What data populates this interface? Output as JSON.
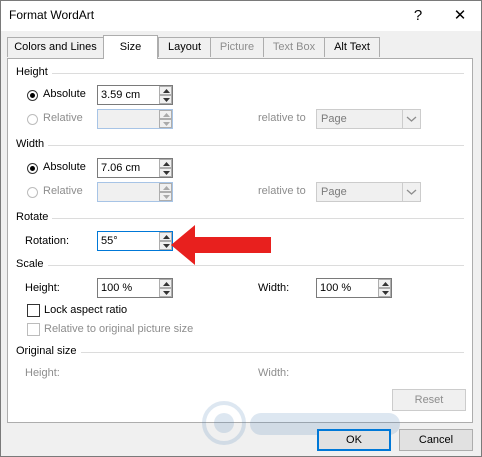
{
  "window": {
    "title": "Format WordArt",
    "help_glyph": "?",
    "close_glyph": "✕"
  },
  "tabs": [
    {
      "label": "Colors and Lines",
      "state": "normal"
    },
    {
      "label": "Size",
      "state": "active"
    },
    {
      "label": "Layout",
      "state": "normal"
    },
    {
      "label": "Picture",
      "state": "disabled"
    },
    {
      "label": "Text Box",
      "state": "disabled"
    },
    {
      "label": "Alt Text",
      "state": "normal"
    }
  ],
  "height": {
    "section": "Height",
    "absolute_label": "Absolute",
    "absolute_value": "3.59 cm",
    "relative_label": "Relative",
    "relative_value": "",
    "relative_to_label": "relative to",
    "relative_to_value": "Page"
  },
  "width": {
    "section": "Width",
    "absolute_label": "Absolute",
    "absolute_value": "7.06 cm",
    "relative_label": "Relative",
    "relative_value": "",
    "relative_to_label": "relative to",
    "relative_to_value": "Page"
  },
  "rotate": {
    "section": "Rotate",
    "rotation_label": "Rotation:",
    "rotation_value": "55°"
  },
  "scale": {
    "section": "Scale",
    "height_label": "Height:",
    "height_value": "100 %",
    "width_label": "Width:",
    "width_value": "100 %",
    "lock_aspect_label": "Lock aspect ratio",
    "relative_original_label": "Relative to original picture size"
  },
  "original_size": {
    "section": "Original size",
    "height_label": "Height:",
    "width_label": "Width:",
    "reset_label": "Reset"
  },
  "footer": {
    "ok_label": "OK",
    "cancel_label": "Cancel"
  },
  "colors": {
    "annotation_arrow": "#e8201e",
    "focus_border": "#0078d7"
  }
}
